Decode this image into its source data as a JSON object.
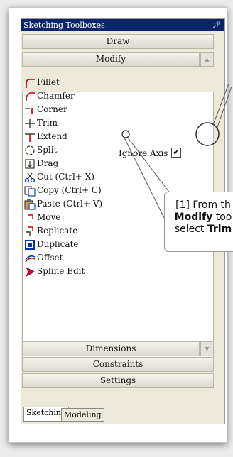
{
  "panel": {
    "title": "Sketching Toolboxes",
    "pin_icon": "pin-icon"
  },
  "sections": {
    "draw": "Draw",
    "modify": "Modify",
    "dimensions": "Dimensions",
    "constraints": "Constraints",
    "settings": "Settings"
  },
  "tools": [
    {
      "label": "Fillet",
      "icon": "fillet-icon"
    },
    {
      "label": "Chamfer",
      "icon": "chamfer-icon"
    },
    {
      "label": "Corner",
      "icon": "corner-icon"
    },
    {
      "label": "Trim",
      "icon": "trim-icon"
    },
    {
      "label": "Extend",
      "icon": "extend-icon"
    },
    {
      "label": "Split",
      "icon": "split-icon"
    },
    {
      "label": "Drag",
      "icon": "drag-icon"
    },
    {
      "label": "Cut (Ctrl+ X)",
      "icon": "cut-icon"
    },
    {
      "label": "Copy (Ctrl+ C)",
      "icon": "copy-icon"
    },
    {
      "label": "Paste (Ctrl+ V)",
      "icon": "paste-icon"
    },
    {
      "label": "Move",
      "icon": "move-icon"
    },
    {
      "label": "Replicate",
      "icon": "replicate-icon"
    },
    {
      "label": "Duplicate",
      "icon": "duplicate-icon"
    },
    {
      "label": "Offset",
      "icon": "offset-icon"
    },
    {
      "label": "Spline Edit",
      "icon": "spline-edit-icon"
    }
  ],
  "ignore_axis": {
    "label": "Ignore Axis",
    "checked": true,
    "check_mark": "✔"
  },
  "tabs": {
    "sketching": "Sketching",
    "modeling": "Modeling"
  },
  "callout": {
    "line1": "[1] From th",
    "line2_bold": "Modify",
    "line2_rest": " too",
    "line3_pre": "select ",
    "line3_bold": "Trim"
  },
  "colors": {
    "titlebar": "#0a246a",
    "panel_bg": "#ece9d8",
    "icon_red": "#cc0000",
    "icon_blue": "#0033aa"
  }
}
